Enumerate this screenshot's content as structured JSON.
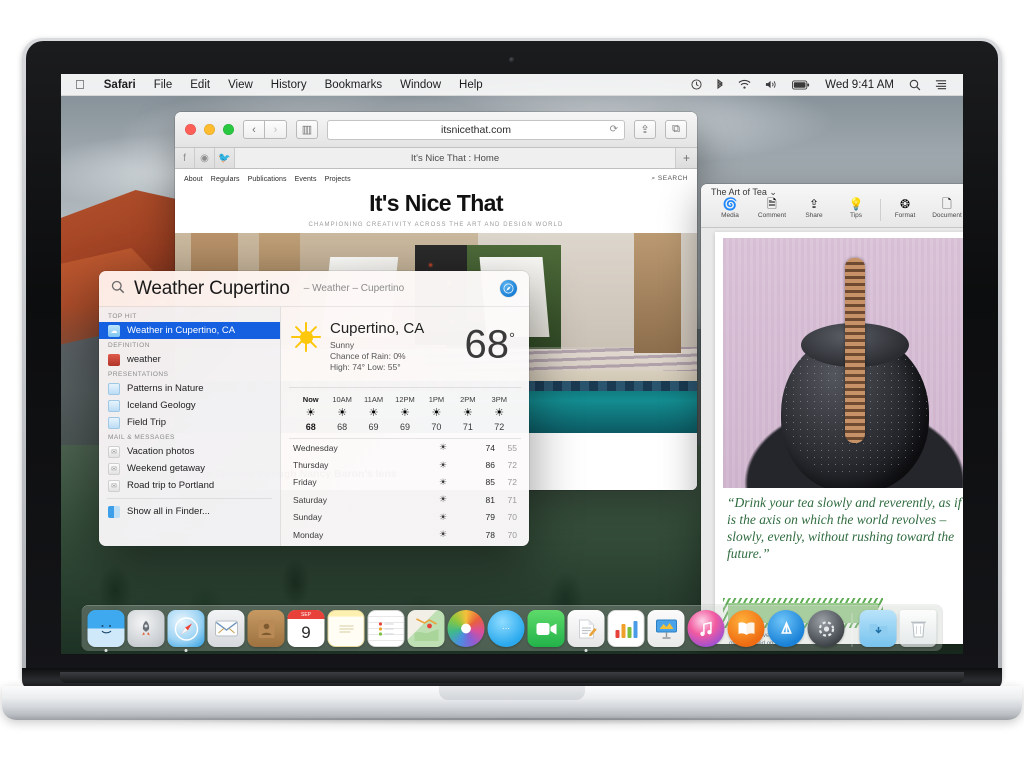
{
  "menubar": {
    "apple": "",
    "items": [
      {
        "label": "Safari",
        "bold": true
      },
      {
        "label": "File",
        "bold": false
      },
      {
        "label": "Edit",
        "bold": false
      },
      {
        "label": "View",
        "bold": false
      },
      {
        "label": "History",
        "bold": false
      },
      {
        "label": "Bookmarks",
        "bold": false
      },
      {
        "label": "Window",
        "bold": false
      },
      {
        "label": "Help",
        "bold": false
      }
    ],
    "status_icons": [
      "time-machine-icon",
      "bluetooth-icon",
      "wifi-icon",
      "volume-icon",
      "battery-icon"
    ],
    "clock": "Wed 9:41 AM",
    "search_glyph": "⌕",
    "notification_glyph": "☰"
  },
  "safari": {
    "url": "itsnicethat.com",
    "reload_glyph": "⟳",
    "sidebar_glyph": "▥",
    "back_glyph": "‹",
    "forward_glyph": "›",
    "share_glyph": "⇪",
    "tabs_glyph": "⧉",
    "tab_title": "It's Nice That : Home",
    "new_tab_glyph": "+",
    "social": [
      "facebook-icon",
      "instagram-icon",
      "twitter-icon"
    ],
    "site": {
      "nav": [
        "About",
        "Regulars",
        "Publications",
        "Events",
        "Projects"
      ],
      "search_label": "SEARCH",
      "logo": "It's Nice That",
      "tagline": "CHAMPIONING CREATIVITY ACROSS THE ART AND DESIGN WORLD",
      "article_headline": "Palm Springs through Nancy Baron's lens"
    }
  },
  "pages": {
    "doc_title": "The Art of Tea",
    "title_chevron": "⌄",
    "tools": [
      {
        "label": "Media",
        "icon": "media-icon",
        "glyph": "◉"
      },
      {
        "label": "Comment",
        "icon": "comment-icon",
        "glyph": "▤"
      },
      {
        "label": "Share",
        "icon": "share-icon",
        "glyph": "⇪"
      },
      {
        "label": "Tips",
        "icon": "tips-icon",
        "glyph": "◔"
      },
      {
        "label": "Format",
        "icon": "format-icon",
        "glyph": "A"
      },
      {
        "label": "Document",
        "icon": "document-icon",
        "glyph": "▤"
      }
    ],
    "quote": "“Drink your tea slowly and reverently, as if it is the axis on which the world revolves – slowly, evenly, without rushing toward the future.”",
    "sidebar_text": "In our busy lives, we are often focused on the jobs we have to do"
  },
  "spotlight": {
    "magnifier_glyph": "⌕",
    "query": "Weather Cupertino",
    "completion": "– Weather – Cupertino",
    "app_icon": "safari-compass-icon",
    "app_glyph": "➤",
    "groups": [
      {
        "title": "TOP HIT",
        "items": [
          {
            "label": "Weather in Cupertino, CA",
            "icon": "weather-result-icon",
            "glyph": "☁",
            "selected": true,
            "icon_class": "ic-weather"
          }
        ]
      },
      {
        "title": "DEFINITION",
        "items": [
          {
            "label": "weather",
            "icon": "dictionary-icon",
            "glyph": " ",
            "selected": false,
            "icon_class": "ic-dict"
          }
        ]
      },
      {
        "title": "PRESENTATIONS",
        "items": [
          {
            "label": "Patterns in Nature",
            "icon": "keynote-file-icon",
            "glyph": " ",
            "selected": false,
            "icon_class": "ic-key"
          },
          {
            "label": "Iceland Geology",
            "icon": "keynote-file-icon",
            "glyph": " ",
            "selected": false,
            "icon_class": "ic-key"
          },
          {
            "label": "Field Trip",
            "icon": "keynote-file-icon",
            "glyph": " ",
            "selected": false,
            "icon_class": "ic-key"
          }
        ]
      },
      {
        "title": "MAIL & MESSAGES",
        "items": [
          {
            "label": "Vacation photos",
            "icon": "mail-message-icon",
            "glyph": "✉",
            "selected": false,
            "icon_class": "ic-mail"
          },
          {
            "label": "Weekend getaway",
            "icon": "mail-message-icon",
            "glyph": "✉",
            "selected": false,
            "icon_class": "ic-mail"
          },
          {
            "label": "Road trip to Portland",
            "icon": "mail-message-icon",
            "glyph": "✉",
            "selected": false,
            "icon_class": "ic-mail"
          }
        ]
      }
    ],
    "show_all": {
      "label": "Show all in Finder...",
      "icon": "finder-icon",
      "glyph": " ",
      "icon_class": "ic-finder"
    }
  },
  "weather": {
    "city": "Cupertino, CA",
    "condition": "Sunny",
    "chance_of_rain": "Chance of Rain: 0%",
    "high_low": "High: 74°   Low: 55°",
    "temperature": "68",
    "degree": "°",
    "sun_icon": "sun-icon",
    "hourly": [
      {
        "hour": "Now",
        "icon": "sun-icon",
        "temp": "68",
        "now": true
      },
      {
        "hour": "10AM",
        "icon": "sun-icon",
        "temp": "68",
        "now": false
      },
      {
        "hour": "11AM",
        "icon": "sun-icon",
        "temp": "69",
        "now": false
      },
      {
        "hour": "12PM",
        "icon": "sun-icon",
        "temp": "69",
        "now": false
      },
      {
        "hour": "1PM",
        "icon": "sun-icon",
        "temp": "70",
        "now": false
      },
      {
        "hour": "2PM",
        "icon": "sun-icon",
        "temp": "71",
        "now": false
      },
      {
        "hour": "3PM",
        "icon": "sun-icon",
        "temp": "72",
        "now": false
      }
    ],
    "daily": [
      {
        "day": "Wednesday",
        "icon": "sun-icon",
        "high": "74",
        "low": "55"
      },
      {
        "day": "Thursday",
        "icon": "sun-icon",
        "high": "86",
        "low": "72"
      },
      {
        "day": "Friday",
        "icon": "sun-icon",
        "high": "85",
        "low": "72"
      },
      {
        "day": "Saturday",
        "icon": "sun-icon",
        "high": "81",
        "low": "71"
      },
      {
        "day": "Sunday",
        "icon": "sun-icon",
        "high": "79",
        "low": "70"
      },
      {
        "day": "Monday",
        "icon": "sun-icon",
        "high": "78",
        "low": "70"
      }
    ]
  },
  "dock": {
    "items": [
      {
        "name": "finder",
        "label": "Finder",
        "running": true,
        "cls": "dk-finder",
        "glyph": ""
      },
      {
        "name": "launchpad",
        "label": "Launchpad",
        "running": false,
        "cls": "dk-launchpad",
        "glyph": "🚀"
      },
      {
        "name": "safari",
        "label": "Safari",
        "running": true,
        "cls": "dk-safari",
        "glyph": ""
      },
      {
        "name": "mail",
        "label": "Mail",
        "running": false,
        "cls": "dk-mail",
        "glyph": ""
      },
      {
        "name": "contacts",
        "label": "Contacts",
        "running": false,
        "cls": "dk-contacts",
        "glyph": ""
      },
      {
        "name": "calendar",
        "label": "Calendar",
        "running": false,
        "cls": "dk-calendar",
        "glyph": "",
        "month": "SEP",
        "date": "9"
      },
      {
        "name": "notes",
        "label": "Notes",
        "running": false,
        "cls": "dk-notes",
        "glyph": ""
      },
      {
        "name": "reminders",
        "label": "Reminders",
        "running": false,
        "cls": "dk-reminders",
        "glyph": ""
      },
      {
        "name": "maps",
        "label": "Maps",
        "running": false,
        "cls": "dk-maps",
        "glyph": ""
      },
      {
        "name": "photos",
        "label": "Photos",
        "running": false,
        "cls": "dk-photos",
        "glyph": ""
      },
      {
        "name": "messages",
        "label": "Messages",
        "running": false,
        "cls": "dk-messages",
        "glyph": "⋯"
      },
      {
        "name": "facetime",
        "label": "FaceTime",
        "running": false,
        "cls": "dk-facetime",
        "glyph": "📹"
      },
      {
        "name": "pages",
        "label": "Pages",
        "running": true,
        "cls": "dk-pages",
        "glyph": ""
      },
      {
        "name": "numbers",
        "label": "Numbers",
        "running": false,
        "cls": "dk-numbers",
        "glyph": ""
      },
      {
        "name": "keynote",
        "label": "Keynote",
        "running": false,
        "cls": "dk-keynote",
        "glyph": ""
      },
      {
        "name": "itunes",
        "label": "iTunes",
        "running": false,
        "cls": "dk-itunes",
        "glyph": "♫"
      },
      {
        "name": "ibooks",
        "label": "iBooks",
        "running": false,
        "cls": "dk-ibooks",
        "glyph": "📖"
      },
      {
        "name": "app-store",
        "label": "App Store",
        "running": false,
        "cls": "dk-appstore",
        "glyph": "A"
      },
      {
        "name": "system-preferences",
        "label": "System Preferences",
        "running": false,
        "cls": "dk-syspref",
        "glyph": "⚙"
      }
    ],
    "trailing": [
      {
        "name": "downloads-folder",
        "label": "Downloads",
        "cls": "dk-downloads",
        "glyph": "⤓"
      },
      {
        "name": "trash",
        "label": "Trash",
        "cls": "dk-trash",
        "glyph": "🗑"
      }
    ]
  }
}
